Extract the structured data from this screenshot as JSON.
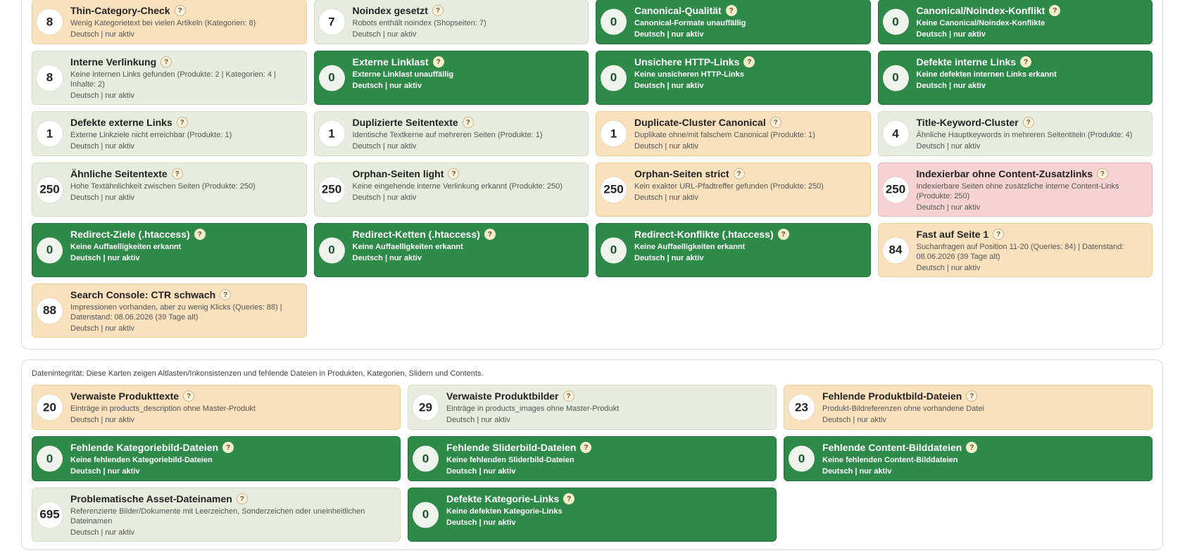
{
  "colors": {
    "cream": "#fae1bd",
    "grey": "#e6eddf",
    "green": "#2e8a48",
    "red": "#f6d2d2"
  },
  "help_label": "?",
  "section_seo": {
    "cards": [
      {
        "count": "8",
        "title": "Thin-Category-Check",
        "desc": "Wenig Kategorietext bei vielen Artikeln (Kategorien: 8)",
        "meta": "Deutsch | nur aktiv",
        "tone": "cream"
      },
      {
        "count": "7",
        "title": "Noindex gesetzt",
        "desc": "Robots enthält noindex (Shopseiten: 7)",
        "meta": "Deutsch | nur aktiv",
        "tone": "grey"
      },
      {
        "count": "0",
        "title": "Canonical-Qualität",
        "desc": "Canonical-Formate unauffällig",
        "meta": "Deutsch | nur aktiv",
        "tone": "green"
      },
      {
        "count": "0",
        "title": "Canonical/Noindex-Konflikt",
        "desc": "Keine Canonical/Noindex-Konflikte",
        "meta": "Deutsch | nur aktiv",
        "tone": "green"
      },
      {
        "count": "8",
        "title": "Interne Verlinkung",
        "desc": "Keine internen Links gefunden (Produkte: 2 | Kategorien: 4 | Inhalte: 2)",
        "meta": "Deutsch | nur aktiv",
        "tone": "grey"
      },
      {
        "count": "0",
        "title": "Externe Linklast",
        "desc": "Externe Linklast unauffällig",
        "meta": "Deutsch | nur aktiv",
        "tone": "green"
      },
      {
        "count": "0",
        "title": "Unsichere HTTP-Links",
        "desc": "Keine unsicheren HTTP-Links",
        "meta": "Deutsch | nur aktiv",
        "tone": "green"
      },
      {
        "count": "0",
        "title": "Defekte interne Links",
        "desc": "Keine defekten internen Links erkannt",
        "meta": "Deutsch | nur aktiv",
        "tone": "green"
      },
      {
        "count": "1",
        "title": "Defekte externe Links",
        "desc": "Externe Linkziele nicht erreichbar (Produkte: 1)",
        "meta": "Deutsch | nur aktiv",
        "tone": "grey"
      },
      {
        "count": "1",
        "title": "Duplizierte Seitentexte",
        "desc": "Identische Textkerne auf mehreren Seiten (Produkte: 1)",
        "meta": "Deutsch | nur aktiv",
        "tone": "grey"
      },
      {
        "count": "1",
        "title": "Duplicate-Cluster Canonical",
        "desc": "Duplikate ohne/mit falschem Canonical (Produkte: 1)",
        "meta": "Deutsch | nur aktiv",
        "tone": "cream"
      },
      {
        "count": "4",
        "title": "Title-Keyword-Cluster",
        "desc": "Ähnliche Hauptkeywords in mehreren Seitentiteln (Produkte: 4)",
        "meta": "Deutsch | nur aktiv",
        "tone": "grey"
      },
      {
        "count": "250",
        "title": "Ähnliche Seitentexte",
        "desc": "Hohe Textähnlichkeit zwischen Seiten (Produkte: 250)",
        "meta": "Deutsch | nur aktiv",
        "tone": "grey"
      },
      {
        "count": "250",
        "title": "Orphan-Seiten light",
        "desc": "Keine eingehende interne Verlinkung erkannt (Produkte: 250)",
        "meta": "Deutsch | nur aktiv",
        "tone": "grey"
      },
      {
        "count": "250",
        "title": "Orphan-Seiten strict",
        "desc": "Kein exakter URL-Pfadtreffer gefunden (Produkte: 250)",
        "meta": "Deutsch | nur aktiv",
        "tone": "cream"
      },
      {
        "count": "250",
        "title": "Indexierbar ohne Content-Zusatzlinks",
        "desc": "Indexierbare Seiten ohne zusätzliche interne Content-Links (Produkte: 250)",
        "meta": "Deutsch | nur aktiv",
        "tone": "red"
      },
      {
        "count": "0",
        "title": "Redirect-Ziele (.htaccess)",
        "desc": "Keine Auffaelligkeiten erkannt",
        "meta": "Deutsch | nur aktiv",
        "tone": "green"
      },
      {
        "count": "0",
        "title": "Redirect-Ketten (.htaccess)",
        "desc": "Keine Auffaelligkeiten erkannt",
        "meta": "Deutsch | nur aktiv",
        "tone": "green"
      },
      {
        "count": "0",
        "title": "Redirect-Konflikte (.htaccess)",
        "desc": "Keine Auffaelligkeiten erkannt",
        "meta": "Deutsch | nur aktiv",
        "tone": "green"
      },
      {
        "count": "84",
        "title": "Fast auf Seite 1",
        "desc": "Suchanfragen auf Position 11-20 (Queries: 84) | Datenstand: 08.06.2026 (39 Tage alt)",
        "meta": "Deutsch | nur aktiv",
        "tone": "cream"
      },
      {
        "count": "88",
        "title": "Search Console: CTR schwach",
        "desc": "Impressionen vorhanden, aber zu wenig Klicks (Queries: 88) | Datenstand: 08.06.2026 (39 Tage alt)",
        "meta": "Deutsch | nur aktiv",
        "tone": "cream"
      }
    ]
  },
  "section_integrity": {
    "intro": "Datenintegrität: Diese Karten zeigen Altlasten/Inkonsistenzen und fehlende Dateien in Produkten, Kategorien, Slidern und Contents.",
    "cards": [
      {
        "count": "20",
        "title": "Verwaiste Produkttexte",
        "desc": "Einträge in products_description ohne Master-Produkt",
        "meta": "Deutsch | nur aktiv",
        "tone": "cream"
      },
      {
        "count": "29",
        "title": "Verwaiste Produktbilder",
        "desc": "Einträge in products_images ohne Master-Produkt",
        "meta": "Deutsch | nur aktiv",
        "tone": "grey"
      },
      {
        "count": "23",
        "title": "Fehlende Produktbild-Dateien",
        "desc": "Produkt-Bildreferenzen ohne vorhandene Datei",
        "meta": "Deutsch | nur aktiv",
        "tone": "cream"
      },
      {
        "count": "0",
        "title": "Fehlende Kategoriebild-Dateien",
        "desc": "Keine fehlenden Kategoriebild-Dateien",
        "meta": "Deutsch | nur aktiv",
        "tone": "green"
      },
      {
        "count": "0",
        "title": "Fehlende Sliderbild-Dateien",
        "desc": "Keine fehlenden Sliderbild-Dateien",
        "meta": "Deutsch | nur aktiv",
        "tone": "green"
      },
      {
        "count": "0",
        "title": "Fehlende Content-Bilddateien",
        "desc": "Keine fehlenden Content-Bilddateien",
        "meta": "Deutsch | nur aktiv",
        "tone": "green"
      },
      {
        "count": "695",
        "title": "Problematische Asset-Dateinamen",
        "desc": "Referenzierte Bilder/Dokumente mit Leerzeichen, Sonderzeichen oder uneinheitlichen Dateinamen",
        "meta": "Deutsch | nur aktiv",
        "tone": "grey"
      },
      {
        "count": "0",
        "title": "Defekte Kategorie-Links",
        "desc": "Keine defekten Kategorie-Links",
        "meta": "Deutsch | nur aktiv",
        "tone": "green"
      }
    ]
  }
}
